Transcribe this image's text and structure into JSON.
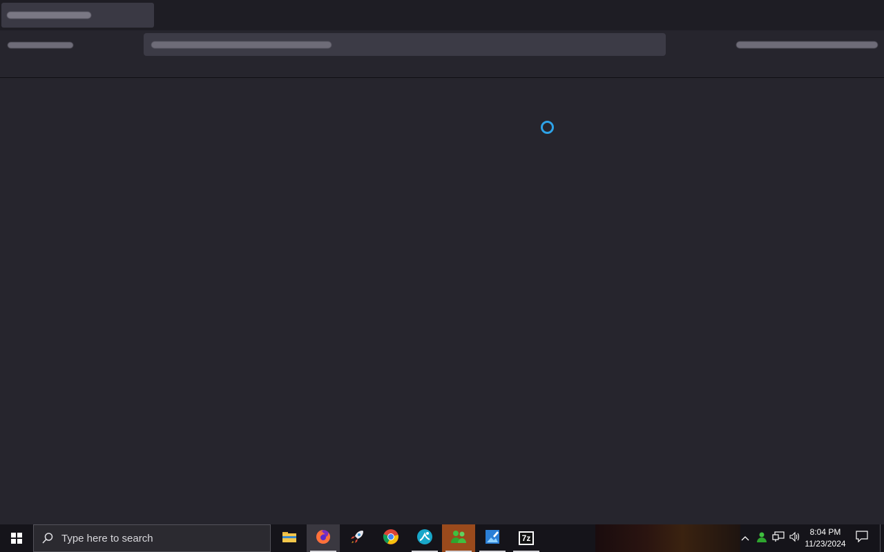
{
  "window": {
    "tab_title": "",
    "url": "",
    "toolbar_left": "",
    "toolbar_right": "",
    "content_state": "loading"
  },
  "taskbar": {
    "search_placeholder": "Type here to search",
    "apps": [
      {
        "name": "File Explorer",
        "icon": "folder-icon"
      },
      {
        "name": "Firefox",
        "icon": "firefox-icon"
      },
      {
        "name": "Rocket app",
        "icon": "rocket-icon"
      },
      {
        "name": "Google Chrome",
        "icon": "chrome-icon"
      },
      {
        "name": "Teal app",
        "icon": "teal-app-icon"
      },
      {
        "name": "Green people app",
        "icon": "people-app-icon"
      },
      {
        "name": "Photo app",
        "icon": "photo-app-icon"
      },
      {
        "name": "7-Zip",
        "icon": "7zip-icon",
        "label": "7z"
      }
    ],
    "clock": {
      "time": "8:04 PM",
      "date": "11/23/2024"
    }
  },
  "colors": {
    "accent": "#2ea3e8",
    "background": "#26252d",
    "taskbar": "#15141a"
  }
}
